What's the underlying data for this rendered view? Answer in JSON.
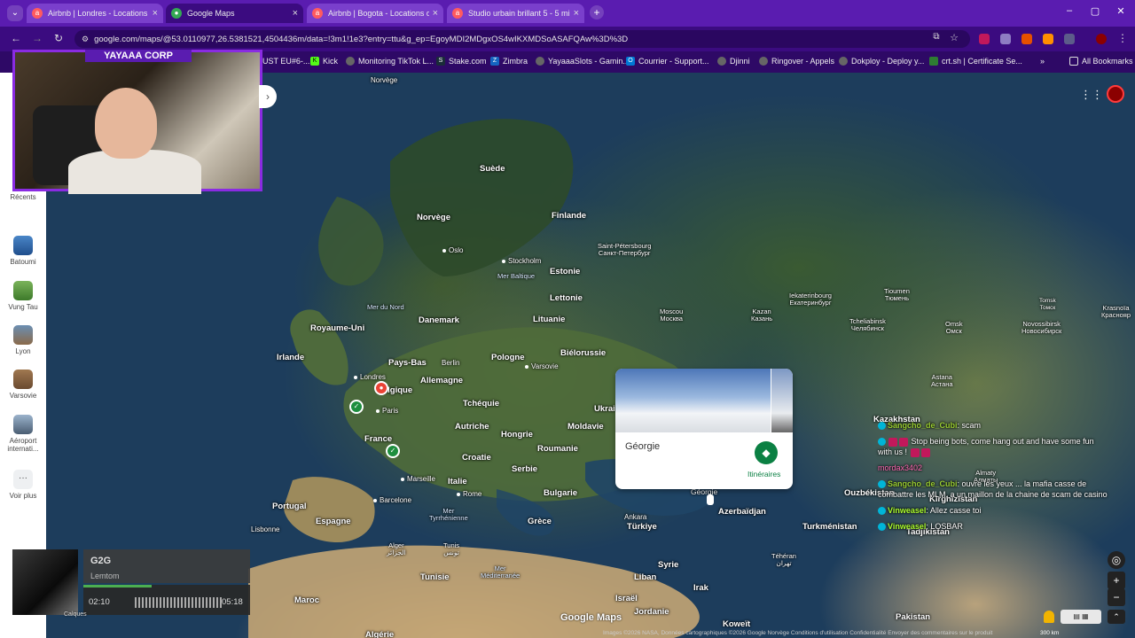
{
  "browser": {
    "tabs": [
      {
        "title": "Airbnb | Londres - Locations de",
        "favicon": "airbnb-icon",
        "active": false
      },
      {
        "title": "Google Maps",
        "favicon": "maps-icon",
        "active": true
      },
      {
        "title": "Airbnb | Bogota - Locations de",
        "favicon": "airbnb-icon",
        "active": false
      },
      {
        "title": "Studio urbain brillant 5 - 5 min",
        "favicon": "airbnb-icon",
        "active": false
      }
    ],
    "url": "google.com/maps/@53.0110977,26.5381521,4504436m/data=!3m1!1e3?entry=ttu&g_ep=EgoyMDI2MDgxOS4wIKXMDSoASAFQAw%3D%3D",
    "bookmarks": [
      "UST EU#6-...",
      "Kick",
      "Monitoring TikTok L...",
      "Stake.com",
      "Zimbra",
      "YayaaaSlots - Gamin...",
      "Courrier - Support...",
      "Djinni",
      "Ringover - Appels",
      "Dokploy - Deploy y...",
      "crt.sh | Certificate Se..."
    ],
    "all_bookmarks": "All Bookmarks",
    "accent_color": "#5a1cb0"
  },
  "sidebar": {
    "items": [
      {
        "label": "Récents"
      },
      {
        "label": "Batoumi"
      },
      {
        "label": "Vung Tau"
      },
      {
        "label": "Lyon"
      },
      {
        "label": "Varsovie"
      },
      {
        "label": "Aéroport internati..."
      },
      {
        "label": "Voir plus"
      }
    ]
  },
  "webcam": {
    "label": "YAYAAA CORP"
  },
  "map": {
    "places": [
      {
        "name": "Norvège",
        "kind": "country"
      },
      {
        "name": "Suède",
        "kind": "country"
      },
      {
        "name": "Finlande",
        "kind": "country"
      },
      {
        "name": "Norvège",
        "kind": "country"
      },
      {
        "name": "Oslo",
        "kind": "city"
      },
      {
        "name": "Stockholm",
        "kind": "city"
      },
      {
        "name": "Saint-Pétersbourg\nСанкт-Петербург",
        "kind": "city"
      },
      {
        "name": "Estonie",
        "kind": "country"
      },
      {
        "name": "Mer Baltique",
        "kind": "sea"
      },
      {
        "name": "Lettonie",
        "kind": "country"
      },
      {
        "name": "Mer du Nord",
        "kind": "sea"
      },
      {
        "name": "Danemark",
        "kind": "country"
      },
      {
        "name": "Lituanie",
        "kind": "country"
      },
      {
        "name": "Moscou\nМосква",
        "kind": "city"
      },
      {
        "name": "Kazan\nКазань",
        "kind": "city"
      },
      {
        "name": "Iekaterinbourg\nЕкатеринбург",
        "kind": "city"
      },
      {
        "name": "Tioumen\nТюмень",
        "kind": "city"
      },
      {
        "name": "Tcheliabinsk\nЧелябинск",
        "kind": "city"
      },
      {
        "name": "Omsk\nОмск",
        "kind": "city"
      },
      {
        "name": "Novossibirsk\nНовосибирск",
        "kind": "city"
      },
      {
        "name": "Tomsk\nТомск",
        "kind": "city"
      },
      {
        "name": "Krasnoïa\nКраснояр",
        "kind": "city"
      },
      {
        "name": "Royaume-Uni",
        "kind": "country"
      },
      {
        "name": "Irlande",
        "kind": "country"
      },
      {
        "name": "Pays-Bas",
        "kind": "country"
      },
      {
        "name": "Berlin",
        "kind": "city"
      },
      {
        "name": "Pologne",
        "kind": "country"
      },
      {
        "name": "Biélorussie",
        "kind": "country"
      },
      {
        "name": "Varsovie",
        "kind": "city"
      },
      {
        "name": "Londres",
        "kind": "city"
      },
      {
        "name": "Belgique",
        "kind": "country"
      },
      {
        "name": "Allemagne",
        "kind": "country"
      },
      {
        "name": "Paris",
        "kind": "city"
      },
      {
        "name": "Tchéquie",
        "kind": "country"
      },
      {
        "name": "Ukrai",
        "kind": "country"
      },
      {
        "name": "Autriche",
        "kind": "country"
      },
      {
        "name": "Hongrie",
        "kind": "country"
      },
      {
        "name": "Moldavie",
        "kind": "country"
      },
      {
        "name": "France",
        "kind": "country"
      },
      {
        "name": "Roumanie",
        "kind": "country"
      },
      {
        "name": "Croatie",
        "kind": "country"
      },
      {
        "name": "Serbie",
        "kind": "country"
      },
      {
        "name": "Italie",
        "kind": "country"
      },
      {
        "name": "Marseille",
        "kind": "city"
      },
      {
        "name": "Rome",
        "kind": "city"
      },
      {
        "name": "Bulgarie",
        "kind": "country"
      },
      {
        "name": "Portugal",
        "kind": "country"
      },
      {
        "name": "Barcelone",
        "kind": "city"
      },
      {
        "name": "Espagne",
        "kind": "country"
      },
      {
        "name": "Lisbonne",
        "kind": "city"
      },
      {
        "name": "Mer\nTyrrhénienne",
        "kind": "sea"
      },
      {
        "name": "Grèce",
        "kind": "country"
      },
      {
        "name": "Ankara",
        "kind": "city"
      },
      {
        "name": "Türkiye",
        "kind": "country"
      },
      {
        "name": "Azerbaïdjan",
        "kind": "country"
      },
      {
        "name": "Géorgie",
        "kind": "country"
      },
      {
        "name": "Alger\nالجزائر",
        "kind": "city"
      },
      {
        "name": "Tunis\nتونس",
        "kind": "city"
      },
      {
        "name": "Tunisie",
        "kind": "country"
      },
      {
        "name": "Mer\nMéditerranée",
        "kind": "sea"
      },
      {
        "name": "Syrie",
        "kind": "country"
      },
      {
        "name": "Liban",
        "kind": "country"
      },
      {
        "name": "Irak",
        "kind": "country"
      },
      {
        "name": "Téhéran\nتهران",
        "kind": "city"
      },
      {
        "name": "Israël",
        "kind": "country"
      },
      {
        "name": "Jordanie",
        "kind": "country"
      },
      {
        "name": "Maroc",
        "kind": "country"
      },
      {
        "name": "Algérie",
        "kind": "country"
      },
      {
        "name": "Koweït",
        "kind": "country"
      },
      {
        "name": "Turkménistan",
        "kind": "country"
      },
      {
        "name": "Kazakhstan",
        "kind": "country"
      },
      {
        "name": "Astana\nАстана",
        "kind": "city"
      },
      {
        "name": "Almaty\nАлматы",
        "kind": "city"
      },
      {
        "name": "Ouzbékistan",
        "kind": "country"
      },
      {
        "name": "Kirghizistan",
        "kind": "country"
      },
      {
        "name": "Tadjikistan",
        "kind": "country"
      },
      {
        "name": "Pakistan",
        "kind": "country"
      }
    ],
    "logo": "Google Maps",
    "attribution": "Images ©2026 NASA, Données cartographiques ©2026 Google   Norvège   Conditions d'utilisation   Confidentialité   Envoyer des commentaires sur le produit",
    "scale": "300 km"
  },
  "popup": {
    "title": "Géorgie",
    "directions_label": "Itinéraires"
  },
  "chat": {
    "lines": [
      {
        "user": "Sangcho_de_Cubi",
        "text": ": scam"
      },
      {
        "user": "",
        "text": "Stop being bots, come hang out and have some fun with us !"
      },
      {
        "user": "mordax3402",
        "text": ""
      },
      {
        "user": "Sangcho_de_Cubi",
        "text": ": ouvre les yeux ... la mafia casse de combattre les MLM, a un maillon de la chaine de scam de casino"
      },
      {
        "user": "Vinweasel",
        "text": ": Allez casse toi"
      },
      {
        "user": "Vinweasel",
        "text": ": LOSBAR"
      }
    ]
  },
  "music": {
    "title": "G2G",
    "artist": "Lemtom",
    "elapsed": "02:10",
    "total": "05:18",
    "progress": 0.41,
    "layers_label": "Calques"
  }
}
